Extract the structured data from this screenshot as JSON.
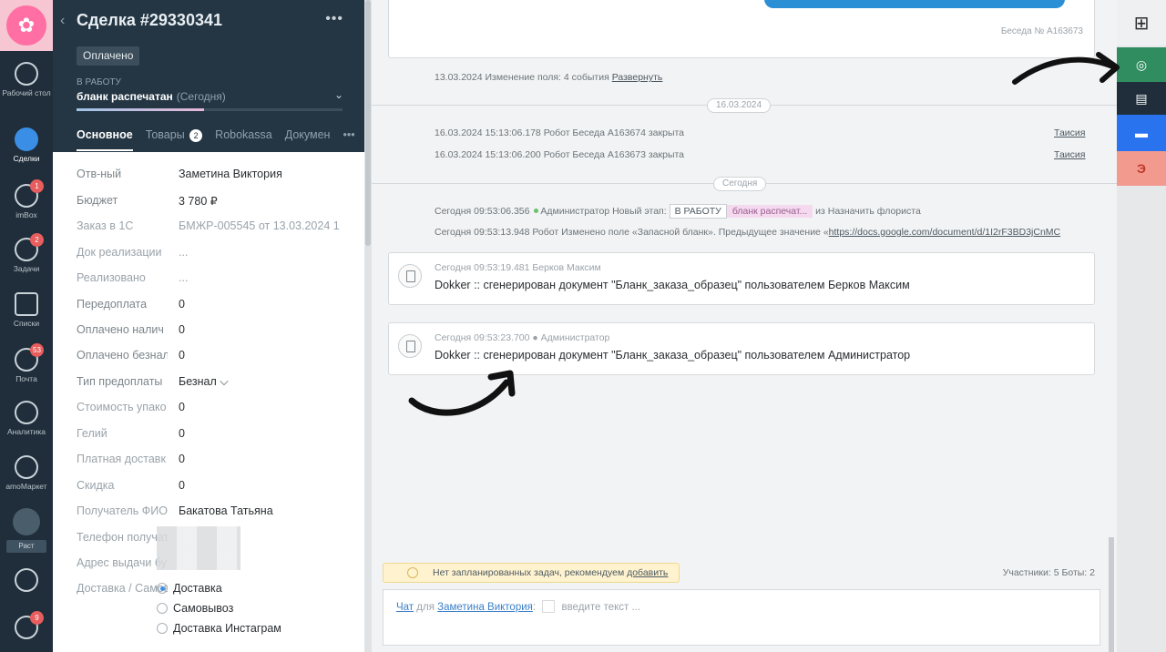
{
  "nav": {
    "items": [
      {
        "label": "Рабочий стол"
      },
      {
        "label": "Сделки"
      },
      {
        "label": "imBox",
        "badge": "1"
      },
      {
        "label": "Задачи",
        "badge": "2"
      },
      {
        "label": "Списки"
      },
      {
        "label": "Почта",
        "badge": "53"
      },
      {
        "label": "Аналитика"
      },
      {
        "label": "amoМаркет"
      }
    ],
    "rast": "Раст",
    "bottom_badge": "9"
  },
  "deal": {
    "title": "Сделка #29330341",
    "status": "Оплачено",
    "stage_group": "В РАБОТУ",
    "stage_name": "бланк распечатан",
    "stage_date": "(Сегодня)",
    "tabs": [
      {
        "label": "Основное"
      },
      {
        "label": "Товары",
        "count": "2"
      },
      {
        "label": "Robokassa"
      },
      {
        "label": "Докумен"
      }
    ],
    "fields": [
      {
        "label": "Отв-ный",
        "value": "Заметина Виктория"
      },
      {
        "label": "Бюджет",
        "value": "3 780 ₽"
      },
      {
        "label": "Заказ в 1С",
        "value": "БМЖР-005545 от 13.03.2024 1"
      },
      {
        "label": "Док реализации",
        "value": "..."
      },
      {
        "label": "Реализовано",
        "value": "..."
      },
      {
        "label": "Передоплата",
        "value": "0"
      },
      {
        "label": "Оплачено налич",
        "value": "0"
      },
      {
        "label": "Оплачено безнал",
        "value": "0"
      },
      {
        "label": "Тип предоплаты",
        "value": "Безнал ⌵"
      },
      {
        "label": "Стоимость упако",
        "value": "0"
      },
      {
        "label": "Гелий",
        "value": "0"
      },
      {
        "label": "Платная доставк",
        "value": "0"
      },
      {
        "label": "Скидка",
        "value": "0"
      },
      {
        "label": "Получатель ФИО",
        "value": "Бакатова Татьяна"
      },
      {
        "label": "Телефон получат",
        "value": ""
      },
      {
        "label": "Адрес выдачи бу",
        "value": ""
      },
      {
        "label": "Доставка / Самов",
        "value": ""
      }
    ],
    "delivery_options": [
      "Доставка",
      "Самовывоз",
      "Доставка Инстаграм"
    ]
  },
  "feed": {
    "beseda": "Беседа № А163673",
    "change_event": "13.03.2024 Изменение поля: 4 события",
    "expand_link": "Развернуть",
    "date1": "16.03.2024",
    "events1": [
      {
        "text": "16.03.2024 15:13:06.178 Робот Беседа А163674 закрыта",
        "user": "Таисия"
      },
      {
        "text": "16.03.2024 15:13:06.200 Робот Беседа А163673 закрыта",
        "user": "Таисия"
      }
    ],
    "date2": "Сегодня",
    "stage_event": {
      "prefix": "Сегодня 09:53:06.356",
      "actor": "Администратор Новый этап:",
      "stage_box": "В РАБОТУ",
      "stage_pink": "бланк распечат...",
      "suffix": "из Назначить флориста"
    },
    "field_event": "Сегодня 09:53:13.948 Робот Изменено поле «Запасной бланк». Предыдущее значение «",
    "field_link": "https://docs.google.com/document/d/1I2rF3BD3jCnMC",
    "docs": [
      {
        "meta": "Сегодня 09:53:19.481 Берков Максим",
        "text": "Dokker :: сгенерирован документ \"Бланк_заказа_образец\" пользователем Берков Максим"
      },
      {
        "meta": "Сегодня 09:53:23.700 ● Администратор",
        "text": "Dokker :: сгенерирован документ \"Бланк_заказа_образец\" пользователем Администратор"
      }
    ],
    "no_tasks": "Нет запланированных задач, рекомендуем",
    "no_tasks_link": "добавить",
    "participants": "Участники: 5   Боты: 2",
    "chat": {
      "label": "Чат",
      "for": "для",
      "user": "Заметина Виктория",
      "placeholder": "введите текст ..."
    }
  },
  "colors": {
    "accent": "#2f8d5f",
    "nav_bg": "#1f2e3a",
    "blue": "#2a73ee"
  }
}
